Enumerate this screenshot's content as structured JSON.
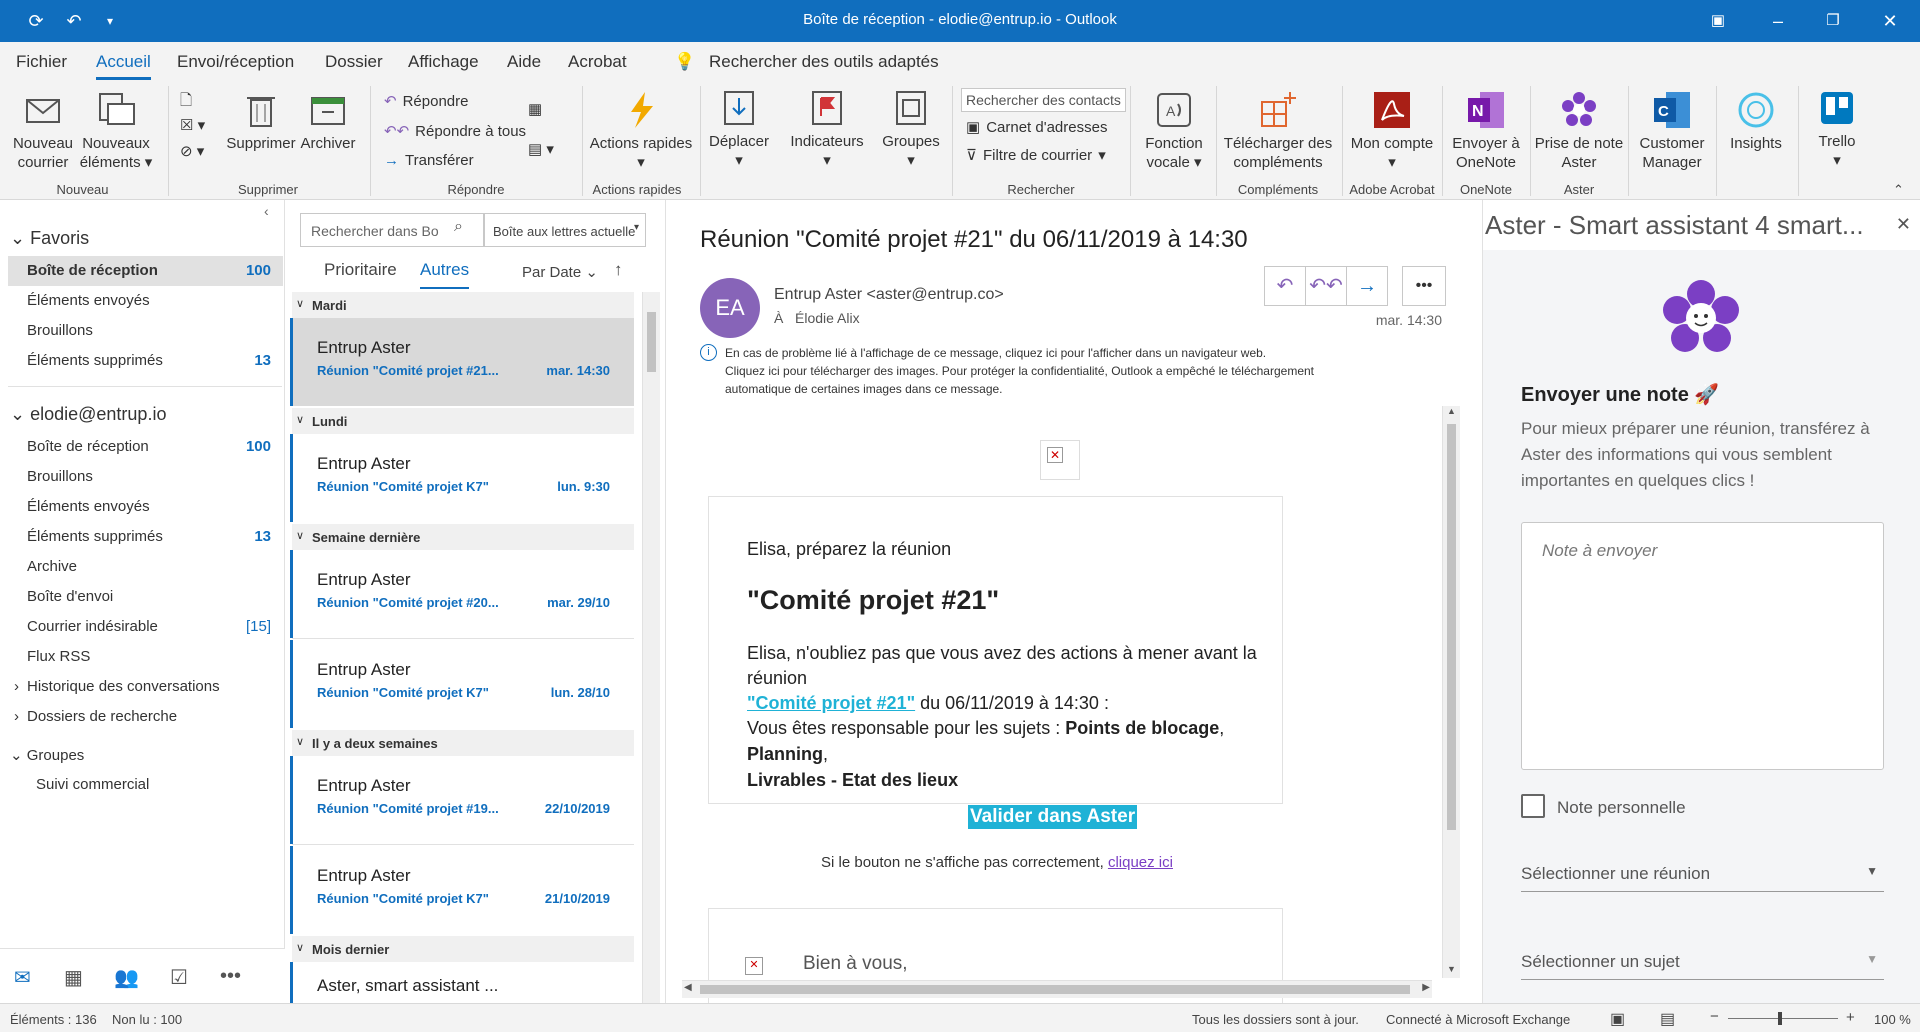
{
  "window": {
    "title": "Boîte de réception - elodie@entrup.io  -  Outlook"
  },
  "menu": [
    "Fichier",
    "Accueil",
    "Envoi/réception",
    "Dossier",
    "Affichage",
    "Aide",
    "Acrobat"
  ],
  "tell_me": "Rechercher des outils adaptés",
  "ribbon": {
    "new_mail": "Nouveau courrier",
    "new_items": "Nouveaux éléments",
    "delete": "Supprimer",
    "archive": "Archiver",
    "reply": "Répondre",
    "reply_all": "Répondre à tous",
    "forward": "Transférer",
    "quick_actions": "Actions rapides",
    "move": "Déplacer",
    "tags": "Indicateurs",
    "groups": "Groupes",
    "search_contacts": "Rechercher des contacts",
    "address_book": "Carnet d'adresses",
    "filter_mail": "Filtre de courrier",
    "voice": "Fonction vocale",
    "get_addins": "Télécharger des compléments",
    "my_account": "Mon compte",
    "onenote": "Envoyer à OneNote",
    "aster_note": "Prise de note Aster",
    "customer_manager": "Customer Manager",
    "insights": "Insights",
    "trello": "Trello",
    "groups_labels": [
      "Nouveau",
      "Supprimer",
      "Répondre",
      "Actions rapides",
      "Rechercher",
      "Compléments",
      "Adobe Acrobat",
      "OneNote",
      "Aster"
    ]
  },
  "folders": {
    "favorites_title": "Favoris",
    "favorites": [
      {
        "name": "Boîte de réception",
        "count": "100"
      },
      {
        "name": "Éléments envoyés",
        "count": ""
      },
      {
        "name": "Brouillons",
        "count": ""
      },
      {
        "name": "Éléments supprimés",
        "count": "13"
      }
    ],
    "account": "elodie@entrup.io",
    "account_folders": [
      {
        "name": "Boîte de réception",
        "count": "100"
      },
      {
        "name": "Brouillons",
        "count": ""
      },
      {
        "name": "Éléments envoyés",
        "count": ""
      },
      {
        "name": "Éléments supprimés",
        "count": "13"
      },
      {
        "name": "Archive",
        "count": ""
      },
      {
        "name": "Boîte d'envoi",
        "count": ""
      },
      {
        "name": "Courrier indésirable",
        "count": "[15]"
      },
      {
        "name": "Flux RSS",
        "count": ""
      },
      {
        "name": "Historique des conversations",
        "count": ""
      },
      {
        "name": "Dossiers de recherche",
        "count": ""
      }
    ],
    "groups_title": "Groupes",
    "groups": [
      "Suivi commercial"
    ]
  },
  "list": {
    "search_placeholder": "Rechercher dans Bo",
    "scope": "Boîte aux lettres actuelle",
    "tab_focused": "Prioritaire",
    "tab_other": "Autres",
    "sort": "Par Date",
    "groups": [
      "Mardi",
      "Lundi",
      "Semaine dernière",
      "Il y a deux semaines",
      "Mois dernier"
    ],
    "items": [
      {
        "from": "Entrup Aster",
        "subject": "Réunion \"Comité projet #21...",
        "date": "mar. 14:30"
      },
      {
        "from": "Entrup Aster",
        "subject": "Réunion \"Comité projet K7\"",
        "date": "lun. 9:30"
      },
      {
        "from": "Entrup Aster",
        "subject": "Réunion \"Comité projet #20...",
        "date": "mar. 29/10"
      },
      {
        "from": "Entrup Aster",
        "subject": "Réunion \"Comité projet K7\"",
        "date": "lun. 28/10"
      },
      {
        "from": "Entrup Aster",
        "subject": "Réunion \"Comité projet #19...",
        "date": "22/10/2019"
      },
      {
        "from": "Entrup Aster",
        "subject": "Réunion \"Comité projet K7\"",
        "date": "21/10/2019"
      },
      {
        "from": "Aster, smart assistant ...",
        "subject": "",
        "date": ""
      }
    ]
  },
  "message": {
    "subject": "Réunion \"Comité projet #21\" du 06/11/2019 à 14:30",
    "initials": "EA",
    "sender": "Entrup Aster <aster@entrup.co>",
    "to_label": "À",
    "to": "Élodie Alix",
    "time": "mar. 14:30",
    "info1": "En cas de problème lié à l'affichage de ce message, cliquez ici pour l'afficher dans un navigateur web.",
    "info2": "Cliquez ici pour télécharger des images. Pour protéger la confidentialité, Outlook a empêché le téléchargement",
    "info3": "automatique de certaines images dans ce message.",
    "greeting": "Elisa, préparez la réunion",
    "meeting_title": "\"Comité projet #21\"",
    "line1": "Elisa, n'oubliez pas que vous avez des actions à mener avant la réunion",
    "link": "\"Comité projet #21\"",
    "line2": " du 06/11/2019 à 14:30 :",
    "resp_prefix": "Vous êtes responsable pour les sujets : ",
    "resp_a": "Points de blocage",
    "resp_b": "Planning",
    "resp_c": "Livrables - Etat des lieux",
    "validate": "Valider dans Aster",
    "fallback": "Si le bouton ne s'affiche pas correctement, ",
    "fallback_link": "cliquez ici",
    "regards": "Bien à vous,"
  },
  "aster": {
    "title": "Aster - Smart assistant 4 smart...",
    "heading": "Envoyer une note 🚀",
    "desc": "Pour mieux préparer une réunion, transférez à Aster des informations qui vous semblent importantes en quelques clics !",
    "note_placeholder": "Note à envoyer",
    "personal": "Note personnelle",
    "select_meeting": "Sélectionner une réunion",
    "select_subject": "Sélectionner un sujet"
  },
  "status": {
    "items": "Éléments : 136",
    "unread": "Non lu : 100",
    "uptodate": "Tous les dossiers sont à jour.",
    "connected": "Connecté à Microsoft Exchange",
    "zoom": "100 %"
  }
}
